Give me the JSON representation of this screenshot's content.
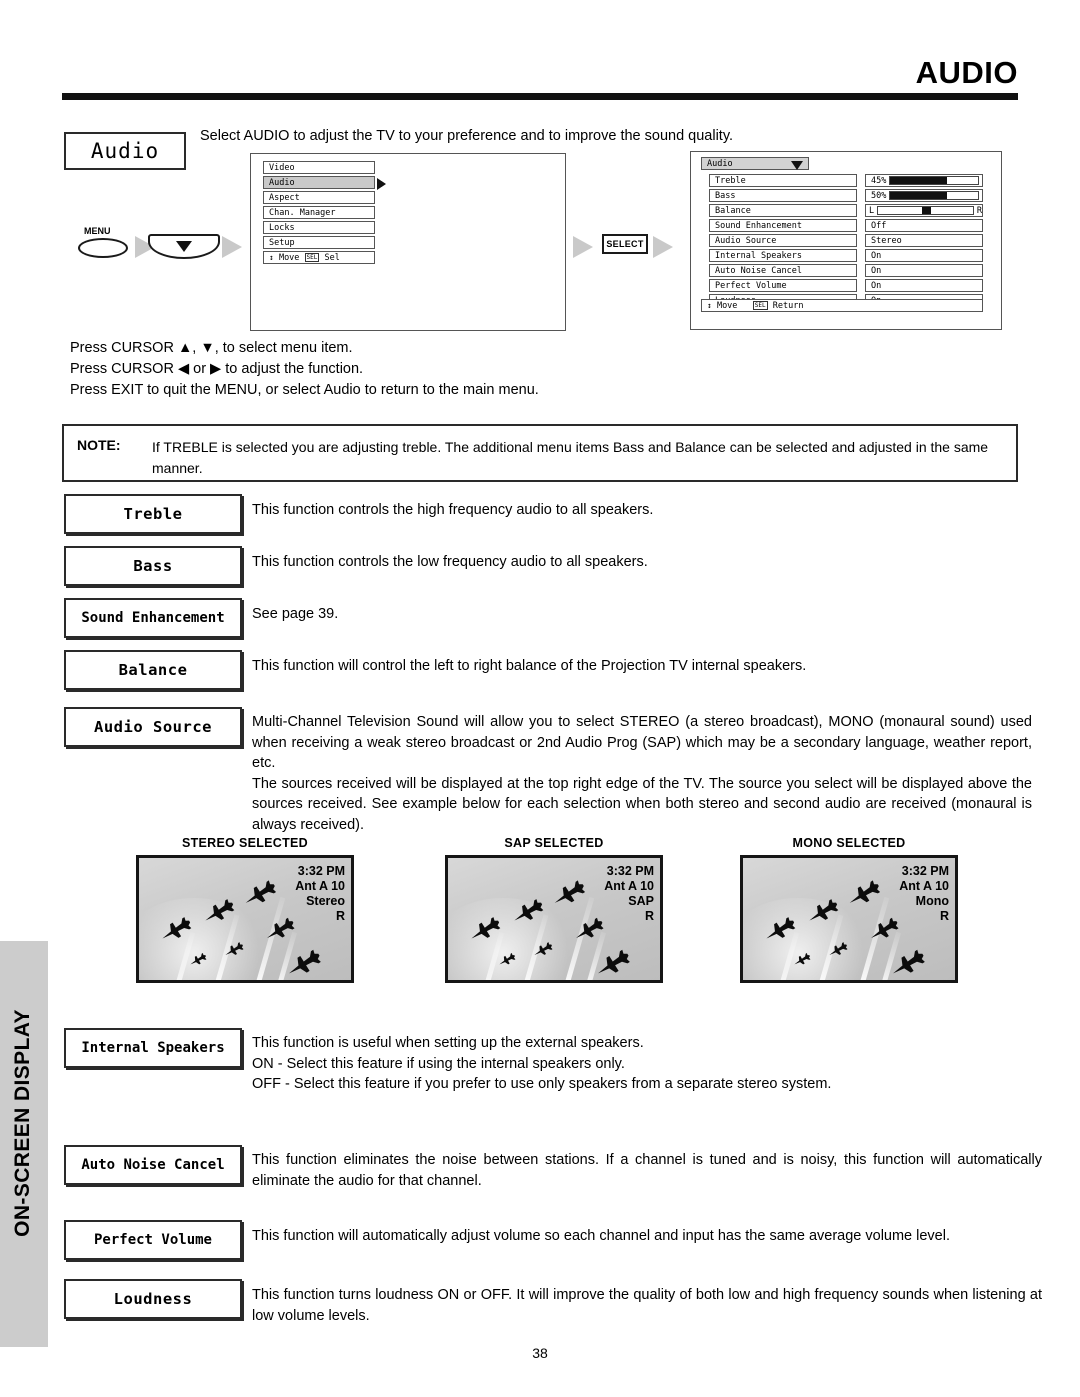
{
  "header": {
    "title": "AUDIO"
  },
  "sidebar": {
    "label": "ON-SCREEN DISPLAY"
  },
  "intro": {
    "chip_label": "Audio",
    "text": "Select AUDIO to adjust the TV to your preference and to improve the sound quality."
  },
  "flow": {
    "menu_label": "MENU",
    "select_label": "SELECT"
  },
  "osd_left": {
    "items": [
      {
        "label": "Video",
        "selected": false
      },
      {
        "label": "Audio",
        "selected": true
      },
      {
        "label": "Aspect",
        "selected": false
      },
      {
        "label": "Chan. Manager",
        "selected": false
      },
      {
        "label": "Locks",
        "selected": false
      },
      {
        "label": "Setup",
        "selected": false
      }
    ],
    "footer": "Move      Sel",
    "footer_move": "Move",
    "footer_sel": "Sel",
    "footer_key": "SEL"
  },
  "osd_right": {
    "header": "Audio",
    "rows": [
      {
        "name": "Treble",
        "value": "45%",
        "kind": "bar",
        "percent": 65
      },
      {
        "name": "Bass",
        "value": "50%",
        "kind": "bar",
        "percent": 65
      },
      {
        "name": "Balance",
        "value": "",
        "kind": "balance",
        "left_label": "L",
        "right_label": "R",
        "position": 50
      },
      {
        "name": "Sound Enhancement",
        "value": "Off",
        "kind": "text"
      },
      {
        "name": "Audio Source",
        "value": "Stereo",
        "kind": "text"
      },
      {
        "name": "Internal Speakers",
        "value": "On",
        "kind": "text"
      },
      {
        "name": "Auto Noise Cancel",
        "value": "On",
        "kind": "text"
      },
      {
        "name": "Perfect Volume",
        "value": "On",
        "kind": "text"
      },
      {
        "name": "Loudness",
        "value": "On",
        "kind": "text"
      }
    ],
    "footer_move": "Move",
    "footer_key": "SEL",
    "footer_return": "Return"
  },
  "cursor_notes": {
    "line1": "Press CURSOR ▲, ▼, to select menu item.",
    "line2": "Press CURSOR  ◀ or ▶ to adjust the function.",
    "line3": "Press EXIT to quit the MENU, or select Audio to return to the main menu."
  },
  "note": {
    "label": "NOTE:",
    "text": "If TREBLE is selected you are adjusting treble.  The additional menu items Bass and Balance can be selected and adjusted in the same manner."
  },
  "functions": [
    {
      "name": "Treble",
      "desc": "This function controls the high frequency audio to all speakers."
    },
    {
      "name": "Bass",
      "desc": "This function controls the low frequency audio to all speakers."
    },
    {
      "name": "Sound Enhancement",
      "desc": "See page 39."
    },
    {
      "name": "Balance",
      "desc": "This function will control the left to right balance of the Projection TV internal speakers."
    },
    {
      "name": "Audio Source",
      "desc": "Multi-Channel Television Sound will allow you to select STEREO (a stereo broadcast), MONO (monaural sound) used when receiving a weak stereo broadcast or 2nd Audio Prog (SAP) which may be a secondary language, weather report, etc.\nThe sources received will be displayed at the top right edge of the TV.  The source you select will be displayed above the sources received.  See example below for each selection when both stereo and second audio are received (monaural is always received)."
    },
    {
      "name": "Internal Speakers",
      "desc": "This function is useful when setting up the external speakers.\nON - Select this feature if using the internal speakers only.\nOFF - Select this feature if you prefer to use only speakers from a separate stereo system."
    },
    {
      "name": "Auto Noise Cancel",
      "desc": "This function eliminates the noise between stations. If a channel is tuned and is noisy, this function will automatically eliminate the audio for that channel."
    },
    {
      "name": "Perfect Volume",
      "desc": "This function will automatically adjust volume so each channel  and input has the same average volume level."
    },
    {
      "name": "Loudness",
      "desc": "This function turns loudness ON or OFF.  It will improve the quality of both low and high frequency sounds when listening at low volume levels."
    }
  ],
  "tv_examples": [
    {
      "caption": "STEREO SELECTED",
      "time": "3:32 PM",
      "channel": "Ant A 10",
      "source": "Stereo",
      "indicator": "R"
    },
    {
      "caption": "SAP SELECTED",
      "time": "3:32 PM",
      "channel": "Ant A 10",
      "source": "SAP",
      "indicator": "R"
    },
    {
      "caption": "MONO SELECTED",
      "time": "3:32 PM",
      "channel": "Ant A 10",
      "source": "Mono",
      "indicator": "R"
    }
  ],
  "page_number": "38"
}
